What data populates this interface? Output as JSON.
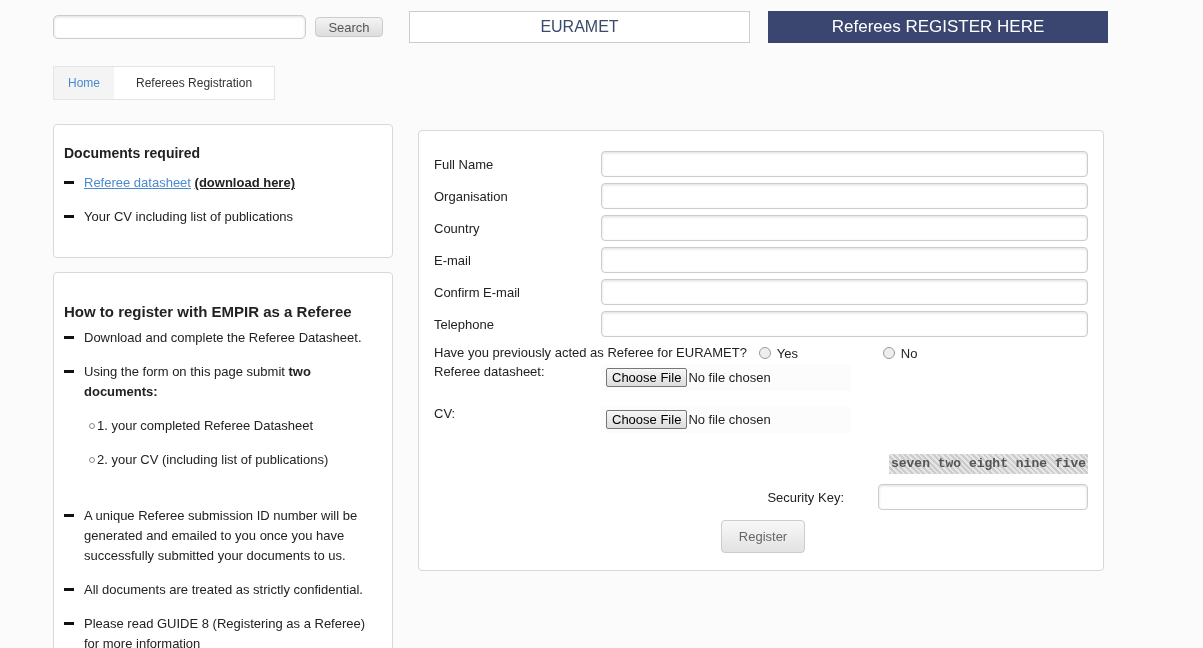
{
  "header": {
    "search": {
      "button": "Search"
    },
    "site_button": "EURAMET",
    "register_banner": "Referees REGISTER HERE"
  },
  "breadcrumb": [
    {
      "label": "Home",
      "kind": "link"
    },
    {
      "label": "Referees Registration",
      "kind": "current"
    }
  ],
  "documents_card": {
    "title": "Documents required",
    "items": [
      {
        "link": "Referee datasheet",
        "text": "(download here)"
      },
      {
        "text": "Your CV including list of publications"
      }
    ]
  },
  "howto_card": {
    "title": "How to register with EMPIR as a Referee",
    "items": [
      {
        "kind": "bullet",
        "text": "Download and complete the Referee Datasheet."
      },
      {
        "kind": "bullet",
        "text": "Using the form on this page submit **two documents:**"
      },
      {
        "kind": "sub",
        "text": "1. your completed Referee Datasheet"
      },
      {
        "kind": "sub",
        "text": "2. your CV (including list of publications)"
      },
      {
        "kind": "bullet",
        "text": "A unique Referee submission ID number will be generated and emailed to you once you have successfully submitted your documents to us."
      },
      {
        "kind": "bullet",
        "text": "All documents are treated as strictly confidential."
      },
      {
        "kind": "bullet",
        "text": "Please read GUIDE 8 (Registering as a Referee) for more information"
      }
    ]
  },
  "form": {
    "fields": [
      {
        "label": "Full Name"
      },
      {
        "label": "Organisation"
      },
      {
        "label": "Country"
      },
      {
        "label": "E-mail"
      },
      {
        "label": "Confirm E-mail"
      },
      {
        "label": "Telephone"
      }
    ],
    "question": {
      "label": "Have you previously acted as Referee for EURAMET?",
      "options": [
        {
          "label": "Yes",
          "checked": false
        },
        {
          "label": "No",
          "checked": false
        }
      ]
    },
    "files": [
      {
        "label": "Referee datasheet:",
        "button": "Choose File",
        "status": "No file chosen"
      },
      {
        "label": "CV:",
        "button": "Choose File",
        "status": "No file chosen"
      }
    ],
    "captcha": "seven two eight nine five",
    "security_key": {
      "label": "Security Key:"
    },
    "submit": "Register"
  }
}
